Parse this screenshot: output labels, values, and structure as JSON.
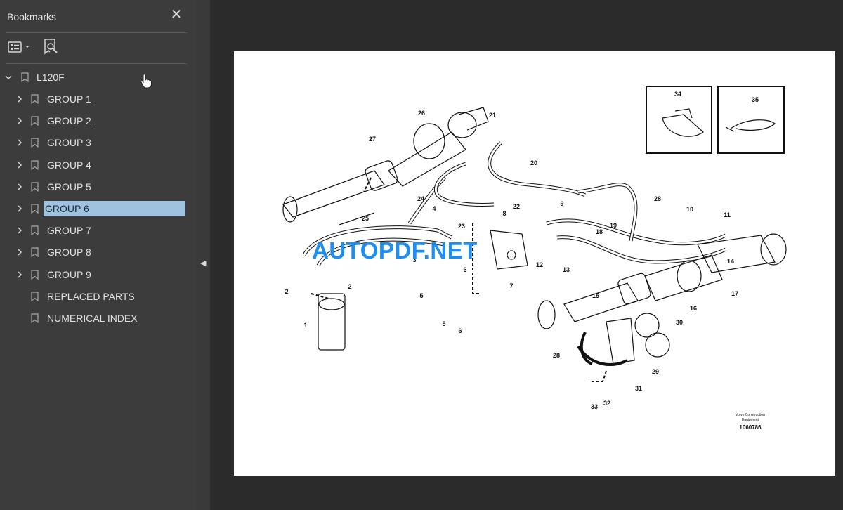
{
  "bookmarks_panel": {
    "title": "Bookmarks",
    "close_glyph": "✕",
    "root": {
      "label": "L120F",
      "expanded": true
    },
    "items": [
      {
        "label": "GROUP 1",
        "expandable": true
      },
      {
        "label": "GROUP 2",
        "expandable": true
      },
      {
        "label": "GROUP 3",
        "expandable": true
      },
      {
        "label": "GROUP 4",
        "expandable": true
      },
      {
        "label": "GROUP 5",
        "expandable": true
      },
      {
        "label": "GROUP 6",
        "expandable": true,
        "selected": true
      },
      {
        "label": "GROUP 7",
        "expandable": true
      },
      {
        "label": "GROUP 8",
        "expandable": true
      },
      {
        "label": "GROUP 9",
        "expandable": true
      },
      {
        "label": "REPLACED PARTS",
        "expandable": false
      },
      {
        "label": "NUMERICAL INDEX",
        "expandable": false
      }
    ]
  },
  "toolbar": {
    "options_icon": "list-options-icon",
    "find_icon": "find-bookmark-icon"
  },
  "document": {
    "watermark": "AUTOPDF.NET",
    "brand_line1": "Volvo Construction",
    "brand_line2": "Equipment",
    "figure_number": "1060786",
    "callouts": [
      "1",
      "2",
      "2",
      "3",
      "4",
      "5",
      "5",
      "6",
      "6",
      "7",
      "8",
      "9",
      "10",
      "11",
      "12",
      "13",
      "14",
      "15",
      "16",
      "17",
      "18",
      "19",
      "20",
      "21",
      "22",
      "23",
      "24",
      "25",
      "26",
      "27",
      "28",
      "28",
      "29",
      "30",
      "31",
      "32",
      "33",
      "34",
      "35"
    ]
  },
  "colors": {
    "selection": "#9ec2df",
    "panel": "#3c3c3c",
    "watermark": "#1f8ef1"
  }
}
